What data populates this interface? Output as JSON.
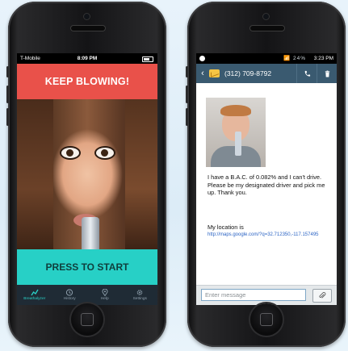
{
  "left_phone": {
    "status": {
      "carrier": "T-Mobile",
      "time": "8:09 PM"
    },
    "banner": "KEEP BLOWING!",
    "start_button": "PRESS TO START",
    "tabs": [
      {
        "label": "Breathalyzer",
        "icon": "chart-line-icon",
        "active": true
      },
      {
        "label": "History",
        "icon": "clock-icon",
        "active": false
      },
      {
        "label": "Help",
        "icon": "location-pin-icon",
        "active": false
      },
      {
        "label": "Settings",
        "icon": "gear-icon",
        "active": false
      }
    ]
  },
  "right_phone": {
    "status": {
      "signal": "📶 24%",
      "time": "3:23 PM"
    },
    "header": {
      "phone_number": "(312) 709-8792"
    },
    "message": {
      "text": "I have a B.A.C. of 0.082% and I can't drive. Please be my designated driver and pick me up. Thank you.",
      "location_label": "My location is",
      "location_url": "http://maps.google.com/?q=32.712350,-117.157495"
    },
    "compose": {
      "placeholder": "Enter message"
    }
  },
  "colors": {
    "banner": "#e9514a",
    "start": "#27d0c6",
    "tabbar": "#1f2b35",
    "active_tab": "#2ad1c7",
    "android_header": "#3a5a70",
    "link": "#2a63c4"
  }
}
